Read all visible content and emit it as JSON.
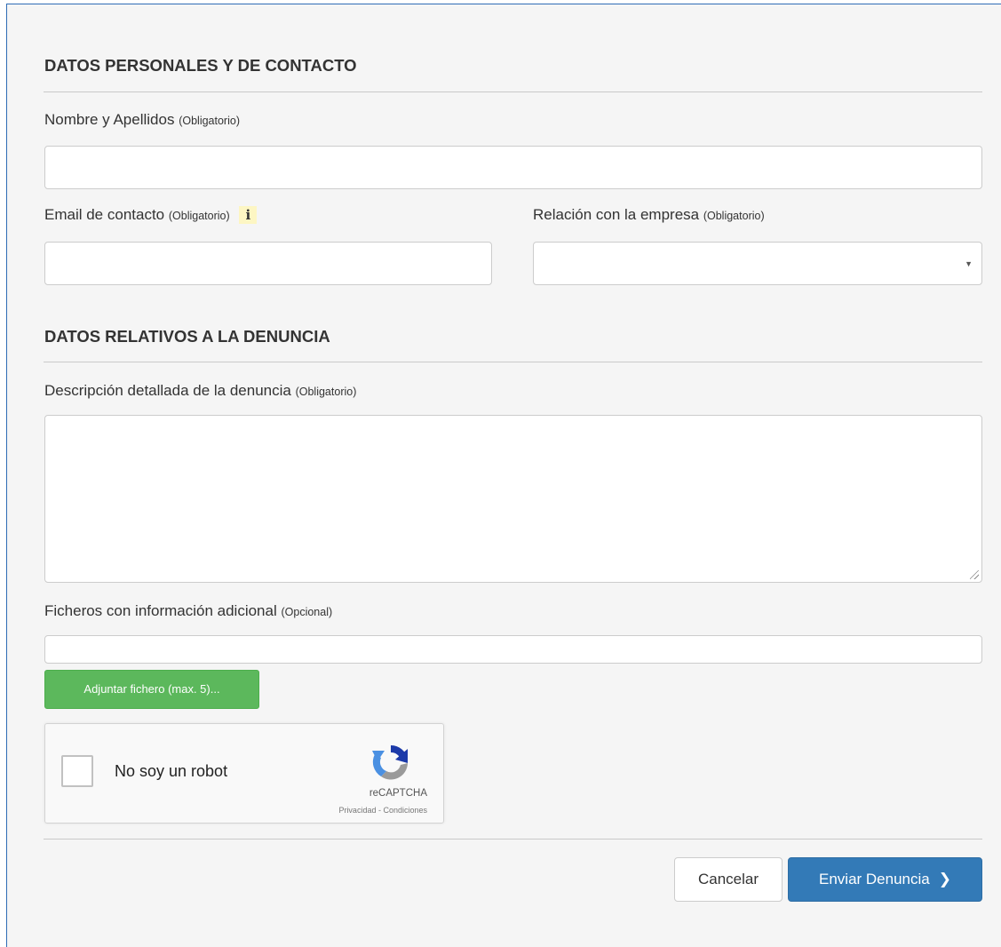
{
  "sections": {
    "personal_title": "DATOS PERSONALES Y DE CONTACTO",
    "complaint_title": "DATOS RELATIVOS A LA DENUNCIA"
  },
  "fields": {
    "name": {
      "label": "Nombre y Apellidos",
      "tag": "(Obligatorio)",
      "value": ""
    },
    "email": {
      "label": "Email de contacto",
      "tag": "(Obligatorio)",
      "info_icon": "info-icon",
      "value": ""
    },
    "relation": {
      "label": "Relación con la empresa",
      "tag": "(Obligatorio)",
      "selected": ""
    },
    "description": {
      "label": "Descripción detallada de la denuncia",
      "tag": "(Obligatorio)",
      "value": ""
    },
    "files": {
      "label": "Ficheros con información adicional",
      "tag": "(Opcional)",
      "value": ""
    }
  },
  "attach_button": "Adjuntar fichero (max. 5)...",
  "captcha": {
    "label": "No soy un robot",
    "brand": "reCAPTCHA",
    "privacy": "Privacidad",
    "separator": " - ",
    "terms": "Condiciones"
  },
  "actions": {
    "cancel": "Cancelar",
    "submit": "Enviar Denuncia",
    "submit_icon": "chevron-right-icon"
  },
  "colors": {
    "panel_bg": "#f5f5f5",
    "primary": "#337ab7",
    "success": "#5cb85c",
    "info_badge": "#fdf6c3"
  }
}
